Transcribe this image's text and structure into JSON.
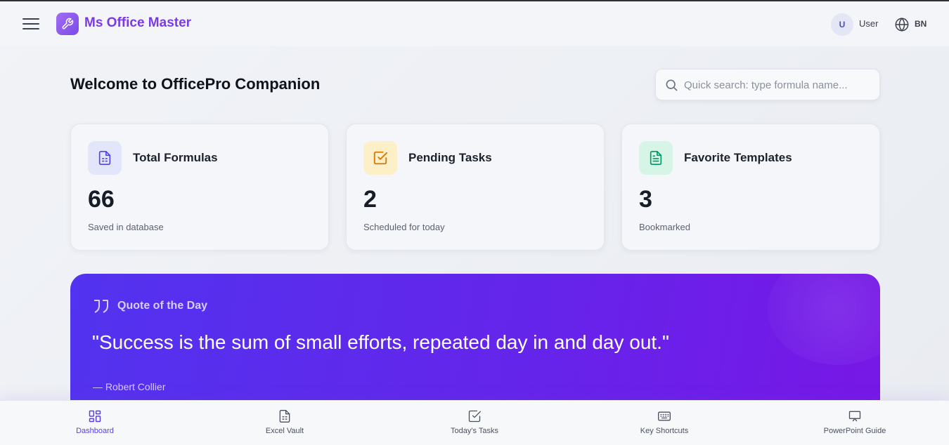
{
  "header": {
    "brand": "Ms Office Master",
    "avatar_initial": "U",
    "user_label": "User",
    "language": "BN"
  },
  "main": {
    "title": "Welcome to OfficePro Companion",
    "search_placeholder": "Quick search: type formula name..."
  },
  "stats": [
    {
      "title": "Total Formulas",
      "value": "66",
      "subtitle": "Saved in database",
      "icon": "document-icon",
      "color": "#4f46e5"
    },
    {
      "title": "Pending Tasks",
      "value": "2",
      "subtitle": "Scheduled for today",
      "icon": "checkbox-icon",
      "color": "#d97706"
    },
    {
      "title": "Favorite Templates",
      "value": "3",
      "subtitle": "Bookmarked",
      "icon": "file-text-icon",
      "color": "#059669"
    }
  ],
  "quote": {
    "heading": "Quote of the Day",
    "text": "\"Success is the sum of small efforts, repeated day in and day out.\"",
    "author": "— Robert Collier"
  },
  "bottom_nav": [
    {
      "label": "Dashboard",
      "icon": "grid-icon",
      "active": true
    },
    {
      "label": "Excel Vault",
      "icon": "spreadsheet-icon",
      "active": false
    },
    {
      "label": "Today's Tasks",
      "icon": "checkbox-icon",
      "active": false
    },
    {
      "label": "Key Shortcuts",
      "icon": "keyboard-icon",
      "active": false
    },
    {
      "label": "PowerPoint Guide",
      "icon": "presentation-icon",
      "active": false
    }
  ]
}
